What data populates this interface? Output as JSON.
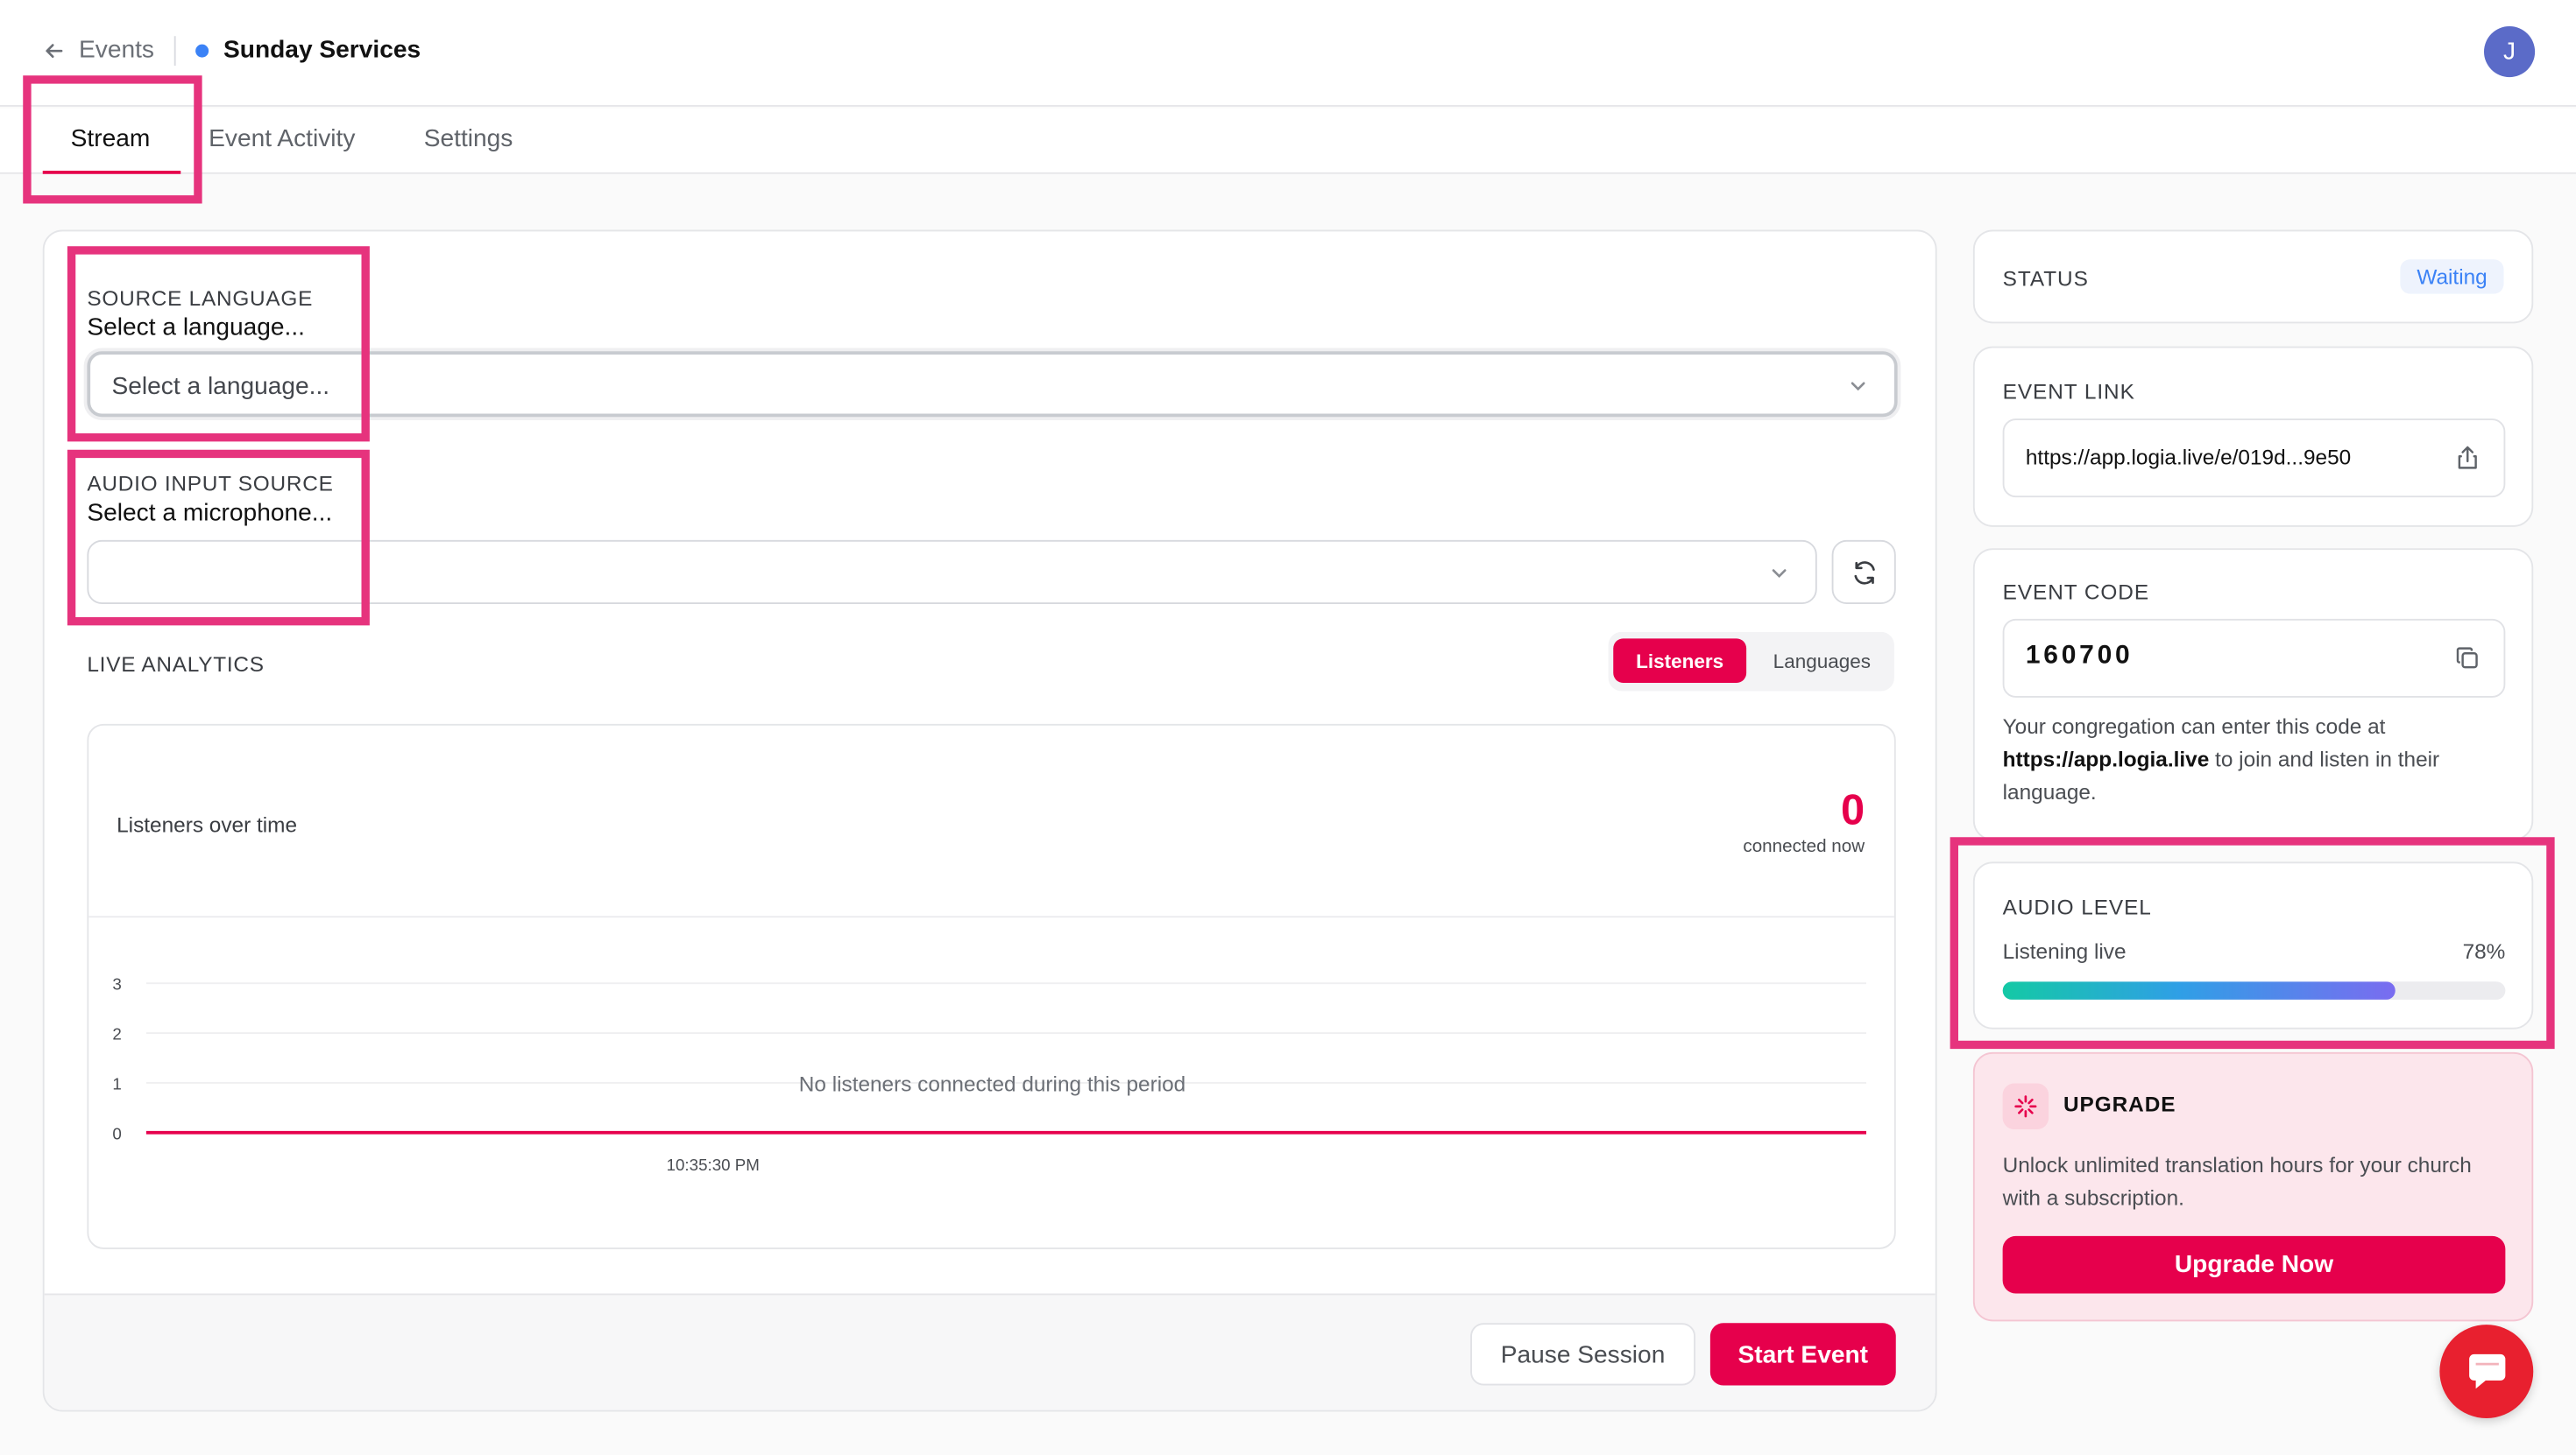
{
  "header": {
    "back_label": "Events",
    "event_title": "Sunday Services",
    "avatar_initial": "J"
  },
  "tabs": [
    {
      "label": "Stream",
      "active": true
    },
    {
      "label": "Event Activity",
      "active": false
    },
    {
      "label": "Settings",
      "active": false
    }
  ],
  "source_language": {
    "label": "SOURCE LANGUAGE",
    "value_text": "Select a language...",
    "placeholder": "Select a language..."
  },
  "audio_input": {
    "label": "AUDIO INPUT SOURCE",
    "value_text": "Select a microphone..."
  },
  "analytics": {
    "label": "LIVE ANALYTICS",
    "toggle": [
      "Listeners",
      "Languages"
    ],
    "active_toggle": "Listeners",
    "chart_title": "Listeners over time",
    "connected_count": "0",
    "connected_label": "connected now",
    "empty_message": "No listeners connected during this period"
  },
  "chart_data": {
    "type": "line",
    "title": "Listeners over time",
    "x": [
      "10:35:30 PM"
    ],
    "series": [
      {
        "values": [
          0
        ]
      }
    ],
    "ylim": [
      0,
      3
    ],
    "yticks": [
      "3",
      "2",
      "1",
      "0"
    ],
    "grid": true,
    "color": "#e6004c"
  },
  "footer": {
    "pause_label": "Pause Session",
    "start_label": "Start Event"
  },
  "status": {
    "label": "STATUS",
    "badge": "Waiting"
  },
  "event_link": {
    "label": "EVENT LINK",
    "url": "https://app.logia.live/e/019d...9e50",
    "icon": "share-icon"
  },
  "event_code": {
    "label": "EVENT CODE",
    "code": "160700",
    "icon": "copy-icon",
    "note_before": "Your congregation can enter this code at ",
    "note_link": "https://app.logia.live",
    "note_after": " to join and listen in their language."
  },
  "audio_level": {
    "label": "AUDIO LEVEL",
    "state": "Listening live",
    "percent_text": "78%",
    "level": 0.78
  },
  "upgrade": {
    "title": "UPGRADE",
    "text": "Unlock unlimited translation hours for your church with a subscription.",
    "button": "Upgrade Now"
  },
  "colors": {
    "accent": "#e6004c",
    "highlight": "#e6337d",
    "status_blue": "#3b82f6"
  }
}
